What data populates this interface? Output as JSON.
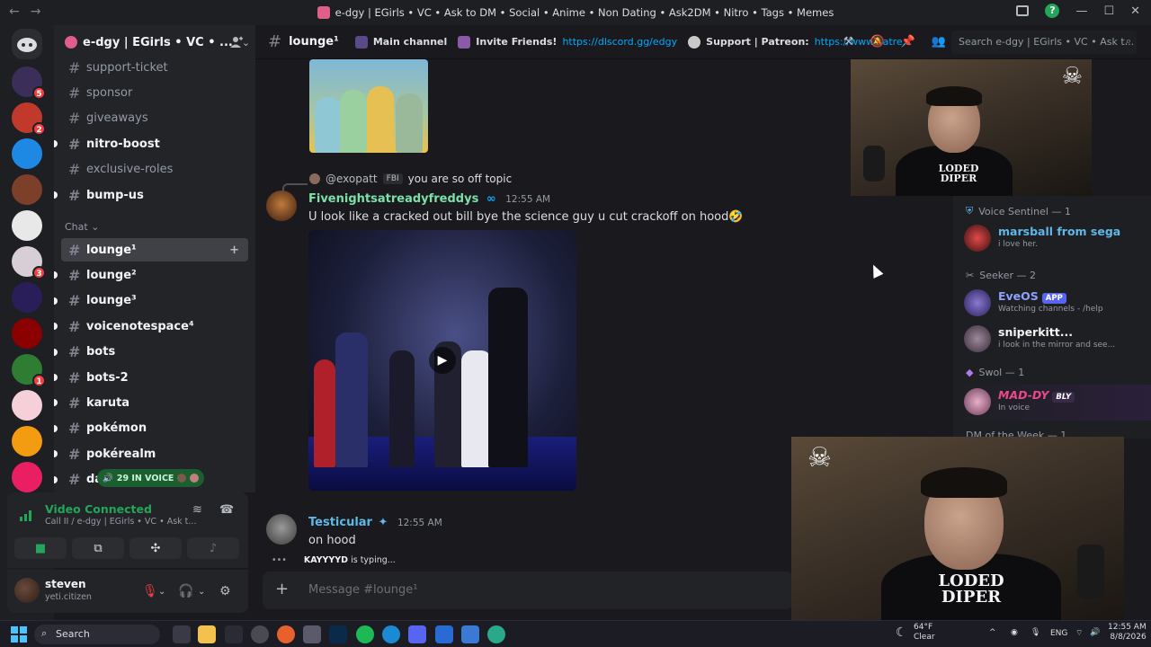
{
  "window": {
    "title": "e-dgy | EGirls • VC • Ask to DM • Social • Anime • Non Dating • Ask2DM • Nitro • Tags • Memes"
  },
  "servers": [
    {
      "badge": "5",
      "color": "#3b2f5a"
    },
    {
      "badge": "2",
      "color": "#c0392b"
    },
    {
      "badge": "",
      "color": "#1e88e5"
    },
    {
      "badge": "",
      "color": "#7b3f2a"
    },
    {
      "badge": "",
      "color": "#e8e8e8"
    },
    {
      "badge": "3",
      "color": "#d8cfd6"
    },
    {
      "badge": "",
      "color": "#2a1e5a"
    },
    {
      "badge": "",
      "color": "#8b0000"
    },
    {
      "badge": "1",
      "color": "#2e7d32"
    },
    {
      "badge": "",
      "color": "#f5d0d8"
    },
    {
      "badge": "",
      "color": "#f39c12"
    },
    {
      "badge": "",
      "color": "#e91e63"
    }
  ],
  "sidebar": {
    "server_name": "e-dgy | EGirls • VC • ...",
    "channels_top": [
      {
        "name": "support-ticket",
        "bold": false
      },
      {
        "name": "sponsor",
        "bold": false
      },
      {
        "name": "giveaways",
        "bold": false
      },
      {
        "name": "nitro-boost",
        "bold": true
      },
      {
        "name": "exclusive-roles",
        "bold": false
      },
      {
        "name": "bump-us",
        "bold": true
      }
    ],
    "category_chat": "Chat",
    "channels_chat": [
      {
        "name": "lounge¹",
        "bold": true,
        "active": true
      },
      {
        "name": "lounge²",
        "bold": true
      },
      {
        "name": "lounge³",
        "bold": true
      },
      {
        "name": "voicenotespace⁴",
        "bold": true
      },
      {
        "name": "bots",
        "bold": true
      },
      {
        "name": "bots-2",
        "bold": true
      },
      {
        "name": "karuta",
        "bold": true
      },
      {
        "name": "pokémon",
        "bold": true
      },
      {
        "name": "pokérealm",
        "bold": true
      },
      {
        "name": "da",
        "bold": true
      }
    ],
    "voice_pill": "29 IN VOICE"
  },
  "voice": {
    "title": "Video Connected",
    "subtitle": "Call II / e-dgy | EGirls • VC • Ask t..."
  },
  "user": {
    "name": "steven",
    "status": "yeti.citizen"
  },
  "header": {
    "channel": "lounge¹",
    "topic_main": "Main channel",
    "topic_invite": "Invite Friends!",
    "invite_link": "https://dlscord.gg/edgy",
    "topic_support": "Support | Patreon:",
    "support_link": "https://www.patre...",
    "search_placeholder": "Search e-dgy | EGirls • VC • Ask t..."
  },
  "messages": {
    "reply_author": "@exopatt",
    "reply_tag": "FBI",
    "reply_text": "you are so off topic",
    "m1_author": "Fivenightsatreadyfreddys",
    "m1_time": "12:55 AM",
    "m1_text": "U look like a cracked out bill bye the science guy u cut crackoff on hood🤣",
    "m2_author": "Testicular",
    "m2_time": "12:55 AM",
    "m2_text": "on hood",
    "typing_user": "KAYYYYD",
    "typing_text": " is typing..."
  },
  "composer": {
    "placeholder": "Message #lounge¹"
  },
  "members": {
    "role1": "Voice Sentinel — 1",
    "role1_members": [
      {
        "name": "marsball from sega",
        "status": "i love her.",
        "color": "#5fb8e8"
      }
    ],
    "role2": "Seeker — 2",
    "role2_members": [
      {
        "name": "EveOS",
        "tag": "APP",
        "status": "Watching channels - /help",
        "color": "#5865f2"
      },
      {
        "name": "sniperkitt...",
        "status": "i look in the mirror and see...",
        "color": "#f2f3f5"
      }
    ],
    "role3": "Swol — 1",
    "role3_members": [
      {
        "name": "MAD-DY",
        "tag": "BLY",
        "status": "In voice",
        "color": "#e84a8a"
      }
    ],
    "role4": "DM of the Week — 1"
  },
  "webcams": {
    "shirt_text": "LODED DIPER"
  },
  "taskbar": {
    "search": "Search",
    "weather_temp": "64°F",
    "weather_desc": "Clear",
    "lang": "ENG",
    "time": "12:55 AM",
    "date": "8/8/2026"
  }
}
